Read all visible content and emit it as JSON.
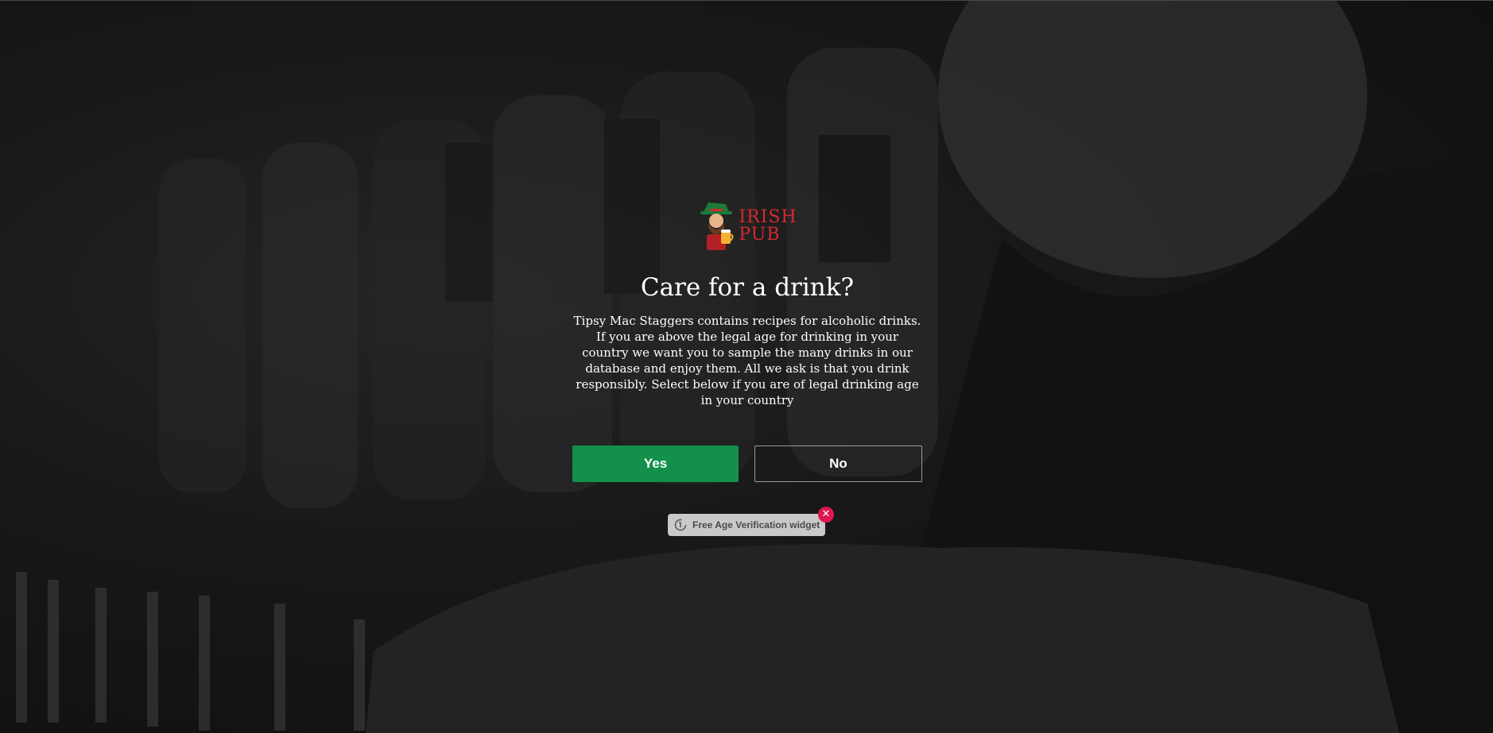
{
  "background": {
    "description_icon": "bartender-photo",
    "tint": "#000000"
  },
  "logo": {
    "icon": "leprechaun-beer-icon",
    "line1": "IRISH",
    "line2": "PUB",
    "color": "#d8282f"
  },
  "modal": {
    "title": "Care for a drink?",
    "body": "Tipsy Mac Staggers contains recipes for alcoholic drinks. If you are above the legal age for drinking in your country we want you to sample the many drinks in our database and enjoy them. All we ask is that you drink responsibly. Select below if you are of legal drinking age in your country",
    "yes_label": "Yes",
    "no_label": "No",
    "yes_color": "#13914a"
  },
  "widget": {
    "icon": "age-verification-icon",
    "label": "Free Age Verification widget",
    "close_icon": "close-icon",
    "close_symbol": "✕",
    "close_color": "#e0174e"
  }
}
